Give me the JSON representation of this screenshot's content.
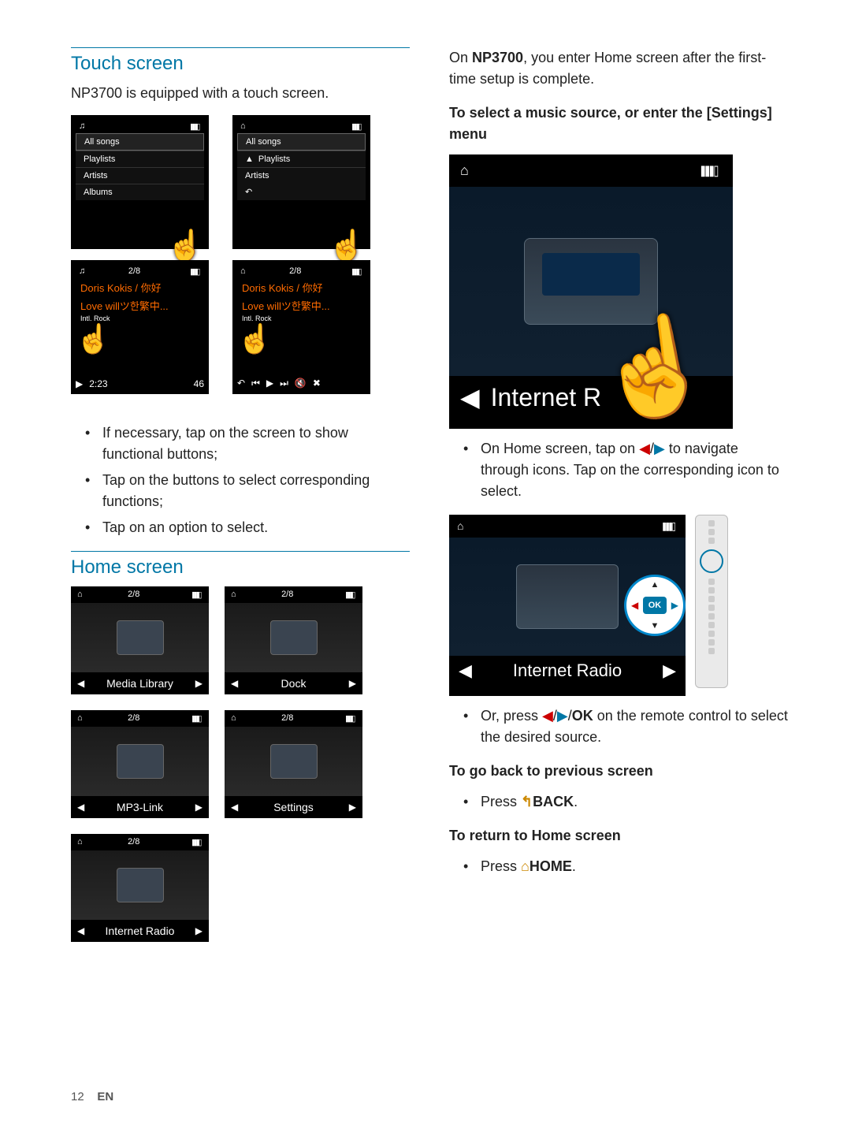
{
  "left": {
    "h_touch": "Touch screen",
    "touch_intro": "NP3700 is equipped with a touch screen.",
    "list_items": [
      "All songs",
      "Playlists",
      "Artists",
      "Albums"
    ],
    "list_items_b": [
      "All songs",
      "Playlists",
      "Artists"
    ],
    "play": {
      "count": "2/8",
      "line1": "Doris Kokis / 你好",
      "line2": "Love willツ한繁中...",
      "sub": "Intl. Rock",
      "time": "2:23",
      "dur": "46"
    },
    "bul1": "If necessary, tap on the screen to show functional buttons;",
    "bul2": "Tap on the buttons to select corresponding functions;",
    "bul3": "Tap on an option to select.",
    "h_home": "Home screen",
    "home": {
      "count": "2/8",
      "items": [
        "Media Library",
        "Dock",
        "MP3-Link",
        "Settings",
        "Internet Radio"
      ]
    }
  },
  "right": {
    "p1a": "On ",
    "p1b": "NP3700",
    "p1c": ", you enter Home screen after the first-time setup is complete.",
    "h_select": "To select a music source, or enter the [Settings] menu",
    "big_label": "Internet R",
    "bul_nav": "On Home screen, tap on ◀/▶ to navigate through icons. Tap on the corresponding icon to select.",
    "radio_label": "Internet Radio",
    "ok": "OK",
    "bul_remote_a": "Or, press ",
    "bul_remote_b": "◀/▶/OK",
    "bul_remote_c": " on the remote control to select the desired source.",
    "h_back": "To go back to previous screen",
    "back_a": "Press ",
    "back_b": "↰BACK",
    "back_c": ".",
    "h_home": "To return to Home screen",
    "home_a": "Press ",
    "home_b": "⌂HOME",
    "home_c": "."
  },
  "footer": {
    "page": "12",
    "lang": "EN"
  },
  "glyph": {
    "home": "⌂",
    "sig": "▮▮▮▯",
    "note": "♫",
    "left": "◀",
    "right": "▶",
    "up": "▲",
    "down": "▼",
    "play": "▶",
    "prev": "⏮",
    "next": "⏭",
    "back": "↶",
    "vol": "🔇",
    "mute": "✖"
  }
}
